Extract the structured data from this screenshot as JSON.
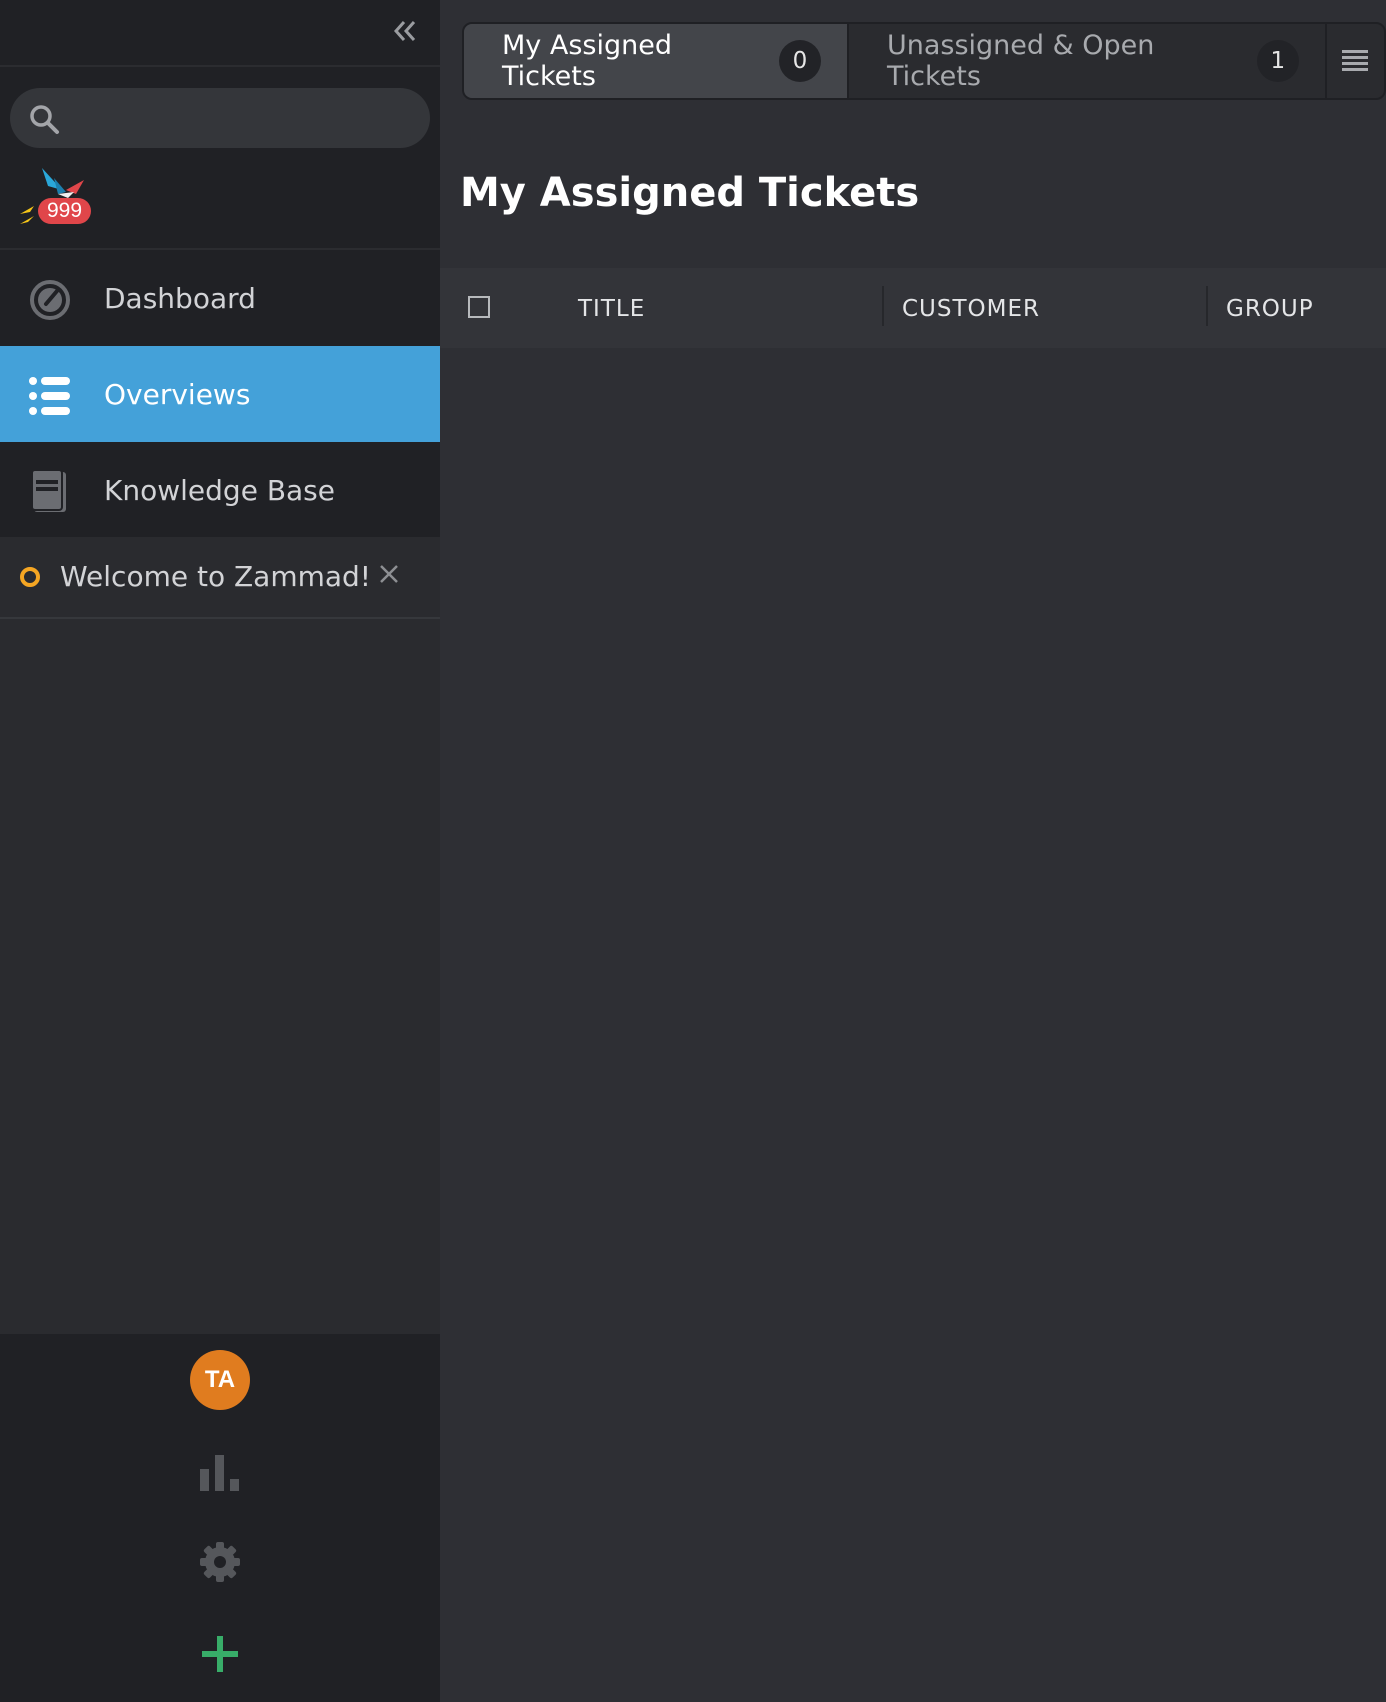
{
  "sidebar": {
    "search_placeholder": "",
    "notification_count": "999",
    "nav": [
      {
        "label": "Dashboard",
        "icon": "dashboard-icon"
      },
      {
        "label": "Overviews",
        "icon": "list-icon",
        "active": true
      },
      {
        "label": "Knowledge Base",
        "icon": "book-icon"
      }
    ],
    "task": {
      "label": "Welcome to Zammad!"
    },
    "user": {
      "initials": "TA",
      "color": "#e07c1f"
    }
  },
  "tabs": [
    {
      "label": "My Assigned Tickets",
      "count": "0"
    },
    {
      "label": "Unassigned & Open Tickets",
      "count": "1"
    }
  ],
  "page": {
    "title": "My Assigned Tickets"
  },
  "table": {
    "columns": [
      "TITLE",
      "CUSTOMER",
      "GROUP"
    ]
  },
  "colors": {
    "accent": "#44a1d9",
    "task_status": "#f5a623",
    "add": "#38ad69",
    "badge": "#e0464a"
  }
}
